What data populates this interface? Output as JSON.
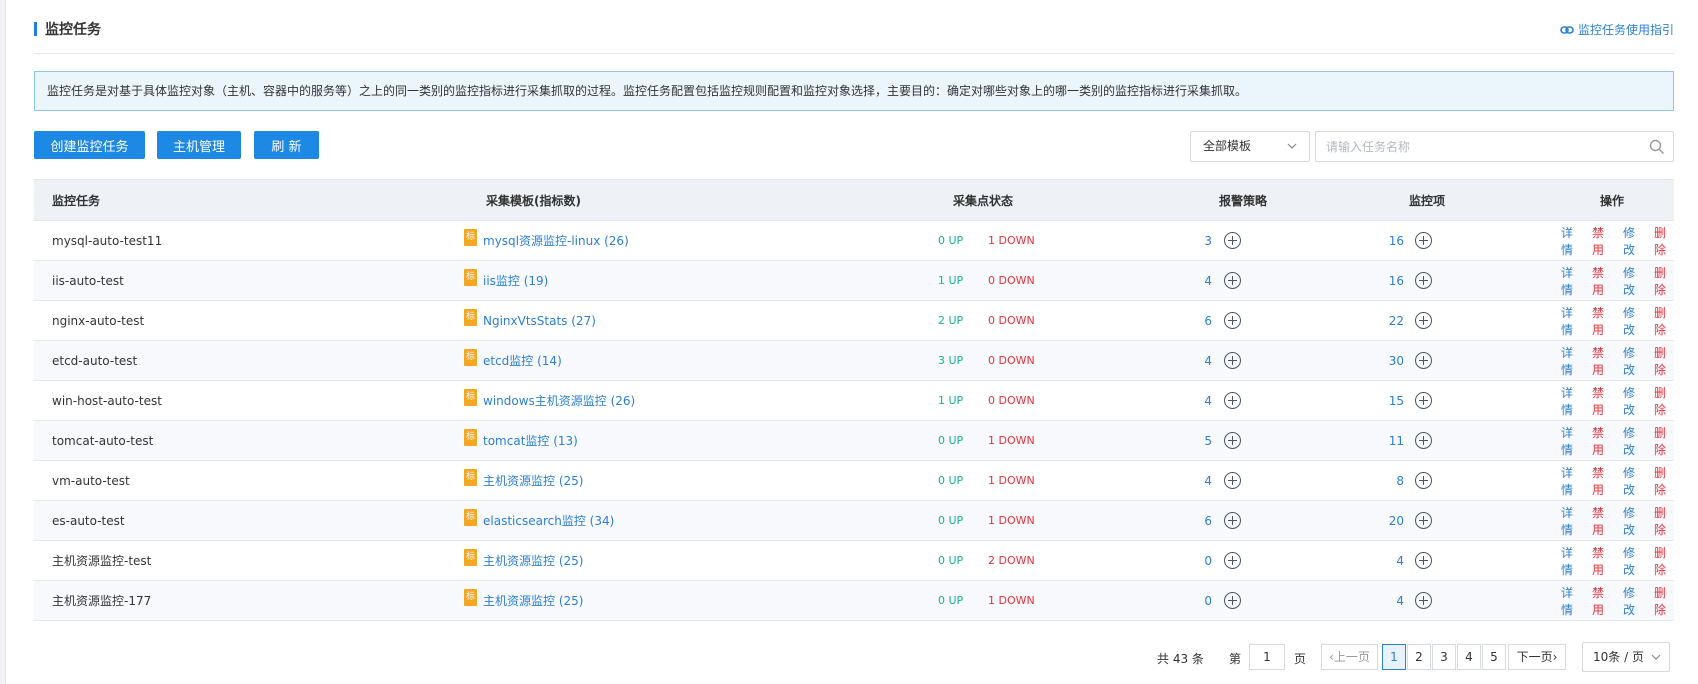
{
  "header": {
    "title": "监控任务",
    "guide_link": "监控任务使用指引"
  },
  "info_text": "监控任务是对基于具体监控对象（主机、容器中的服务等）之上的同一类别的监控指标进行采集抓取的过程。监控任务配置包括监控规则配置和监控对象选择，主要目的：确定对哪些对象上的哪一类别的监控指标进行采集抓取。",
  "toolbar": {
    "create_label": "创建监控任务",
    "host_label": "主机管理",
    "refresh_label": "刷 新",
    "template_select": "全部模板",
    "search_placeholder": "请输入任务名称"
  },
  "table": {
    "columns": [
      "监控任务",
      "采集模板(指标数)",
      "采集点状态",
      "报警策略",
      "监控项",
      "操作"
    ],
    "tag_label": "标",
    "up_suffix": "UP",
    "down_suffix": "DOWN",
    "actions": [
      "详情",
      "禁用",
      "修改",
      "删除"
    ],
    "rows": [
      {
        "task": "mysql-auto-test11",
        "template": "mysql资源监控-linux (26)",
        "up": "0",
        "down": "1",
        "alarm": "3",
        "items": "16"
      },
      {
        "task": "iis-auto-test",
        "template": "iis监控 (19)",
        "up": "1",
        "down": "0",
        "alarm": "4",
        "items": "16"
      },
      {
        "task": "nginx-auto-test",
        "template": "NginxVtsStats (27)",
        "up": "2",
        "down": "0",
        "alarm": "6",
        "items": "22"
      },
      {
        "task": "etcd-auto-test",
        "template": "etcd监控 (14)",
        "up": "3",
        "down": "0",
        "alarm": "4",
        "items": "30"
      },
      {
        "task": "win-host-auto-test",
        "template": "windows主机资源监控 (26)",
        "up": "1",
        "down": "0",
        "alarm": "4",
        "items": "15"
      },
      {
        "task": "tomcat-auto-test",
        "template": "tomcat监控 (13)",
        "up": "0",
        "down": "1",
        "alarm": "5",
        "items": "11"
      },
      {
        "task": "vm-auto-test",
        "template": "主机资源监控 (25)",
        "up": "0",
        "down": "1",
        "alarm": "4",
        "items": "8"
      },
      {
        "task": "es-auto-test",
        "template": "elasticsearch监控 (34)",
        "up": "0",
        "down": "1",
        "alarm": "6",
        "items": "20"
      },
      {
        "task": "主机资源监控-test",
        "template": "主机资源监控 (25)",
        "up": "0",
        "down": "2",
        "alarm": "0",
        "items": "4"
      },
      {
        "task": "主机资源监控-177",
        "template": "主机资源监控 (25)",
        "up": "0",
        "down": "1",
        "alarm": "0",
        "items": "4"
      }
    ]
  },
  "pagination": {
    "total_text": "共 43 条",
    "goto_prefix": "第",
    "goto_value": "1",
    "goto_suffix": "页",
    "prev_label": "上一页",
    "pages": [
      "1",
      "2",
      "3",
      "4",
      "5"
    ],
    "current_page": "1",
    "next_label": "下一页",
    "page_size": "10条 / 页"
  },
  "colors": {
    "primary": "#1e88e5",
    "link": "#2b7fd6",
    "up": "#19b394",
    "down": "#e8313a",
    "tag": "#f5a623"
  }
}
